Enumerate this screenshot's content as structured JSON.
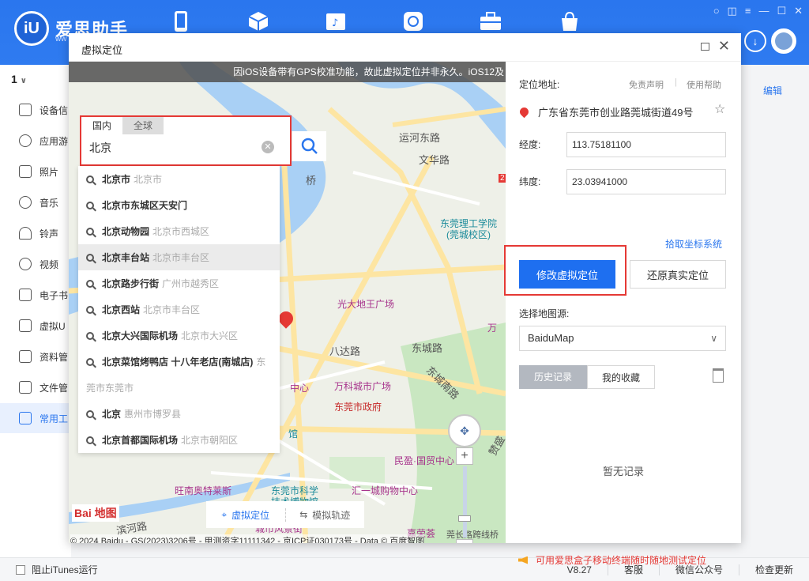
{
  "app": {
    "name": "爱思助手",
    "logo_mark": "iU",
    "sub": "ww"
  },
  "topnav": {
    "icons": [
      "phone-icon",
      "cube-icon",
      "music-folder-icon",
      "refresh-icon",
      "toolbox-icon",
      "bag-icon"
    ]
  },
  "window_controls": [
    "○",
    "◫",
    "≡",
    "—",
    "☐",
    "✕"
  ],
  "sidebar": {
    "device": "1",
    "items": [
      {
        "label": "设备信"
      },
      {
        "label": "应用游"
      },
      {
        "label": "照片"
      },
      {
        "label": "音乐"
      },
      {
        "label": "铃声"
      },
      {
        "label": "视频"
      },
      {
        "label": "电子书"
      },
      {
        "label": "虚拟U"
      },
      {
        "label": "资料管"
      },
      {
        "label": "文件管"
      },
      {
        "label": "常用工"
      }
    ]
  },
  "edit_link": "编辑",
  "dialog": {
    "title": "虚拟定位"
  },
  "map": {
    "banner": "因iOS设备带有GPS校准功能，故此虚拟定位并非永久。iOS12及",
    "tabs": [
      "国内",
      "全球"
    ],
    "search_value": "北京",
    "suggestions": [
      {
        "main": "北京市",
        "sub": "北京市"
      },
      {
        "main": "北京市东城区天安门",
        "sub": ""
      },
      {
        "main": "北京动物园",
        "sub": "北京市西城区"
      },
      {
        "main": "北京丰台站",
        "sub": "北京市丰台区"
      },
      {
        "main": "北京路步行街",
        "sub": "广州市越秀区"
      },
      {
        "main": "北京西站",
        "sub": "北京市丰台区"
      },
      {
        "main": "北京大兴国际机场",
        "sub": "北京市大兴区"
      },
      {
        "main": "北京菜馆烤鸭店 十八年老店(南城店)",
        "sub": "东"
      },
      {
        "main": "北京",
        "sub": "惠州市博罗县"
      },
      {
        "main": "北京首都国际机场",
        "sub": "北京市朝阳区"
      }
    ],
    "group_label": "莞市东莞市",
    "pois": {
      "p1": "运河东路",
      "p2": "文华路",
      "p3": "东莞理工学院",
      "p3b": "(莞城校区)",
      "p4": "光大地王广场",
      "p5": "八达路",
      "p6": "东城路",
      "p7": "东城南路",
      "p8": "万科城市广场",
      "p9": "东莞市政府",
      "p10": "中心",
      "p11": "馆",
      "p12": "民盈·国贸中心",
      "p13": "旺南奥特莱斯",
      "p14": "东莞市科学",
      "p14b": "技术博物馆",
      "p15": "汇一城购物中心",
      "p16": "城市风景街",
      "p17": "嘉荣荟",
      "p18": "莞长路跨线桥",
      "p19": "滨河路",
      "p20": "万",
      "p21": "桥",
      "p22": "赞盛",
      "p23": "2"
    },
    "mode_tabs": [
      "虚拟定位",
      "模拟轨迹"
    ],
    "baidu_logo": "Bai 地图",
    "copyright": "© 2024 Baidu - GS(2023)3206号 - 甲测资字11111342 - 京ICP证030173号 - Data © 百度智图"
  },
  "panel": {
    "address_label": "定位地址:",
    "disclaimer": "免责声明",
    "help": "使用帮助",
    "address": "广东省东莞市创业路莞城街道49号",
    "lng_label": "经度:",
    "lng_value": "113.75181100",
    "lat_label": "纬度:",
    "lat_value": "23.03941000",
    "pick_link": "拾取坐标系统",
    "modify_btn": "修改虚拟定位",
    "restore_btn": "还原真实定位",
    "source_label": "选择地图源:",
    "source_value": "BaiduMap",
    "hist_tabs": [
      "历史记录",
      "我的收藏"
    ],
    "empty": "暂无记录",
    "tip": "可用爱思盒子移动终端随时随地测试定位"
  },
  "statusbar": {
    "itunes": "阻止iTunes运行",
    "version": "V8.27",
    "service": "客服",
    "wechat": "微信公众号",
    "update": "检查更新"
  }
}
